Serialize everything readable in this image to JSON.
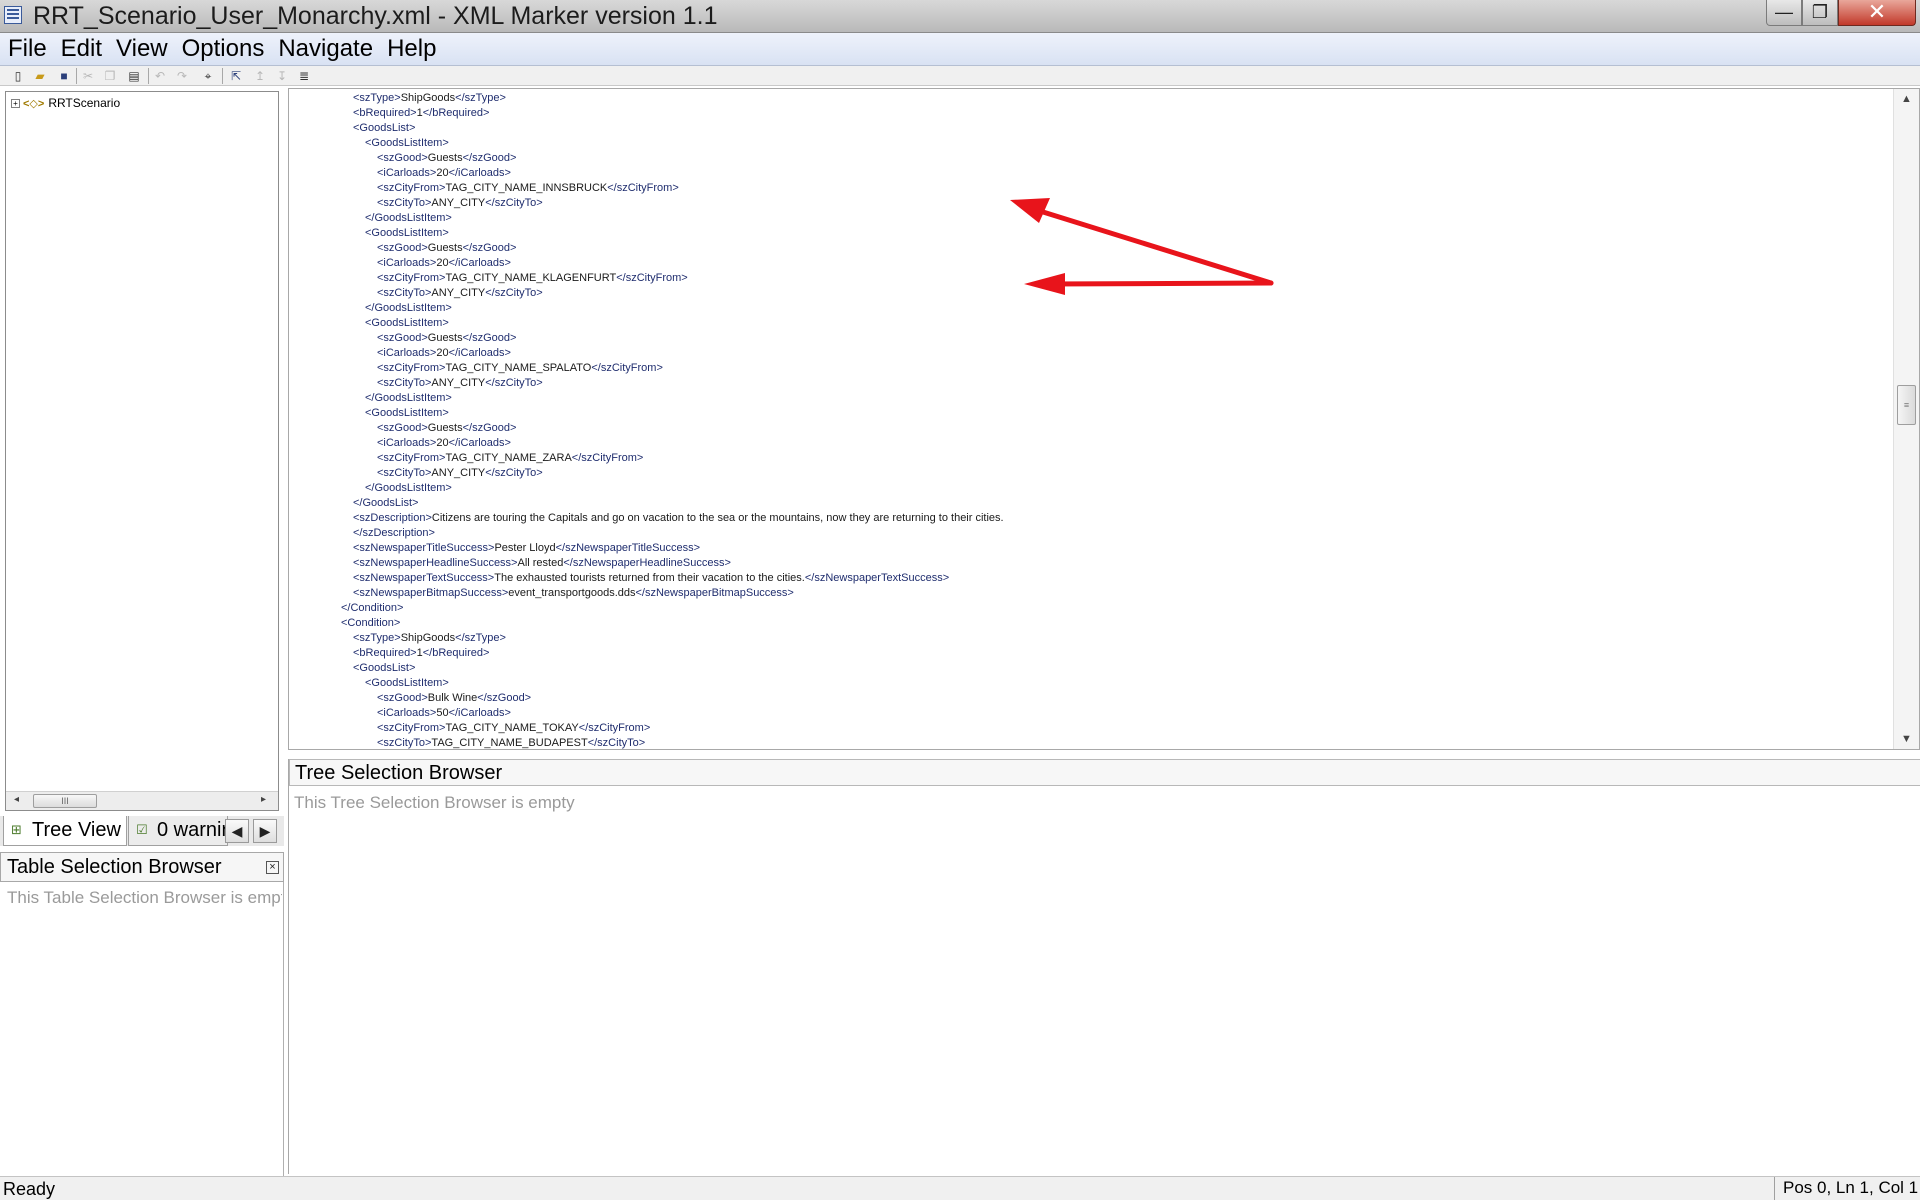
{
  "window": {
    "title": "RRT_Scenario_User_Monarchy.xml  -  XML Marker version 1.1",
    "controls": {
      "minimize": "—",
      "restore": "❐",
      "close": "✕"
    }
  },
  "menu": [
    "File",
    "Edit",
    "View",
    "Options",
    "Navigate",
    "Help"
  ],
  "toolbar": {
    "icons": [
      "new-file-icon",
      "open-folder-icon",
      "save-icon",
      "cut-icon",
      "copy-icon",
      "paste-icon",
      "undo-icon",
      "redo-icon",
      "find-binoculars-icon",
      "tree-expand-icon",
      "move-up-icon",
      "move-down-icon",
      "format-lines-icon"
    ]
  },
  "tree": {
    "root_label": "RRTScenario",
    "expander": "+",
    "node_icon": "<◇>",
    "scroll_thumb": "III"
  },
  "left_tabs": {
    "tree_view": "Tree View",
    "warnings": "0 warnir",
    "nav_prev": "◀",
    "nav_next": "▶"
  },
  "table_selection": {
    "title": "Table Selection Browser",
    "close": "×",
    "empty_text": "This Table Selection Browser is empty"
  },
  "xml_lines": [
    {
      "indent": 0,
      "text": "<Condition>"
    },
    {
      "indent": 1,
      "tag": "szType",
      "value": "ShipGoods"
    },
    {
      "indent": 1,
      "tag": "bRequired",
      "value": "1"
    },
    {
      "indent": 1,
      "text": "<GoodsList>"
    },
    {
      "indent": 2,
      "text": "<GoodsListItem>"
    },
    {
      "indent": 3,
      "tag": "szGood",
      "value": "Guests"
    },
    {
      "indent": 3,
      "tag": "iCarloads",
      "value": "20"
    },
    {
      "indent": 3,
      "tag": "szCityFrom",
      "value": "TAG_CITY_NAME_INNSBRUCK"
    },
    {
      "indent": 3,
      "tag": "szCityTo",
      "value": "ANY_CITY"
    },
    {
      "indent": 2,
      "text": "</GoodsListItem>"
    },
    {
      "indent": 2,
      "text": "<GoodsListItem>"
    },
    {
      "indent": 3,
      "tag": "szGood",
      "value": "Guests"
    },
    {
      "indent": 3,
      "tag": "iCarloads",
      "value": "20"
    },
    {
      "indent": 3,
      "tag": "szCityFrom",
      "value": "TAG_CITY_NAME_KLAGENFURT"
    },
    {
      "indent": 3,
      "tag": "szCityTo",
      "value": "ANY_CITY"
    },
    {
      "indent": 2,
      "text": "</GoodsListItem>"
    },
    {
      "indent": 2,
      "text": "<GoodsListItem>"
    },
    {
      "indent": 3,
      "tag": "szGood",
      "value": "Guests"
    },
    {
      "indent": 3,
      "tag": "iCarloads",
      "value": "20"
    },
    {
      "indent": 3,
      "tag": "szCityFrom",
      "value": "TAG_CITY_NAME_SPALATO"
    },
    {
      "indent": 3,
      "tag": "szCityTo",
      "value": "ANY_CITY"
    },
    {
      "indent": 2,
      "text": "</GoodsListItem>"
    },
    {
      "indent": 2,
      "text": "<GoodsListItem>"
    },
    {
      "indent": 3,
      "tag": "szGood",
      "value": "Guests"
    },
    {
      "indent": 3,
      "tag": "iCarloads",
      "value": "20"
    },
    {
      "indent": 3,
      "tag": "szCityFrom",
      "value": "TAG_CITY_NAME_ZARA"
    },
    {
      "indent": 3,
      "tag": "szCityTo",
      "value": "ANY_CITY"
    },
    {
      "indent": 2,
      "text": "</GoodsListItem>"
    },
    {
      "indent": 1,
      "text": "</GoodsList>"
    },
    {
      "indent": 1,
      "tag": "szDescription",
      "value": "Citizens are touring the Capitals and go on vacation to the sea or the mountains, now they are returning to their cities.",
      "open_only": true
    },
    {
      "indent": 1,
      "text": "</szDescription>"
    },
    {
      "indent": 1,
      "tag": "szNewspaperTitleSuccess",
      "value": "Pester Lloyd"
    },
    {
      "indent": 1,
      "tag": "szNewspaperHeadlineSuccess",
      "value": "All rested"
    },
    {
      "indent": 1,
      "tag": "szNewspaperTextSuccess",
      "value": "The exhausted tourists returned from their vacation to the cities."
    },
    {
      "indent": 1,
      "tag": "szNewspaperBitmapSuccess",
      "value": "event_transportgoods.dds"
    },
    {
      "indent": 0,
      "text": "</Condition>"
    },
    {
      "indent": 0,
      "text": "<Condition>"
    },
    {
      "indent": 1,
      "tag": "szType",
      "value": "ShipGoods"
    },
    {
      "indent": 1,
      "tag": "bRequired",
      "value": "1"
    },
    {
      "indent": 1,
      "text": "<GoodsList>"
    },
    {
      "indent": 2,
      "text": "<GoodsListItem>"
    },
    {
      "indent": 3,
      "tag": "szGood",
      "value": "Bulk Wine"
    },
    {
      "indent": 3,
      "tag": "iCarloads",
      "value": "50"
    },
    {
      "indent": 3,
      "tag": "szCityFrom",
      "value": "TAG_CITY_NAME_TOKAY"
    },
    {
      "indent": 3,
      "tag": "szCityTo",
      "value": "TAG_CITY_NAME_BUDAPEST"
    }
  ],
  "annotation": {
    "arrow_color": "#e8141b"
  },
  "tree_selection": {
    "title": "Tree Selection Browser",
    "empty_text": "This Tree Selection Browser is empty"
  },
  "status": {
    "text": "Ready",
    "position": "Pos  0, Ln 1, Col 1"
  },
  "colors": {
    "tag": "#1f2d6e",
    "menubar": "#dde5f4",
    "close_button": "#c2392a"
  }
}
